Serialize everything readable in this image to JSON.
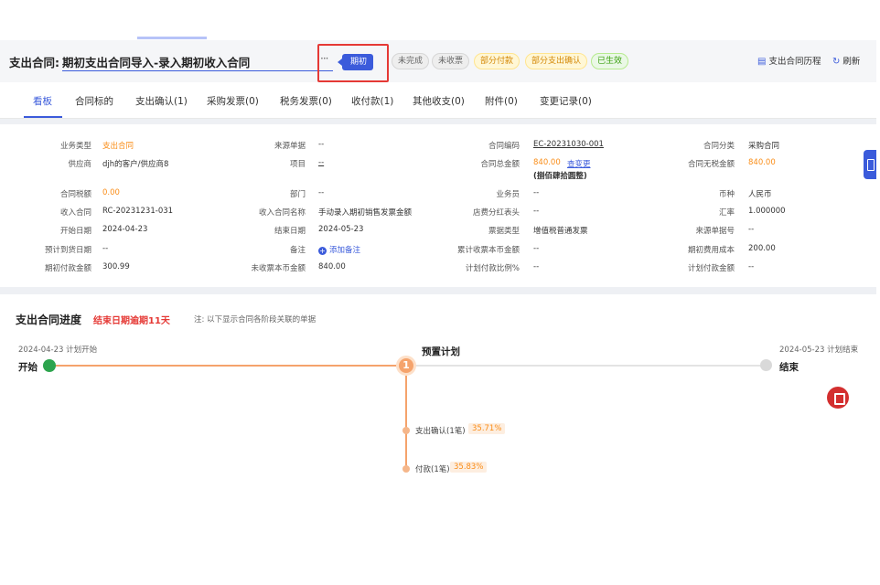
{
  "header": {
    "title_label": "支出合同:",
    "title_value": "期初支出合同导入-录入期初收入合同",
    "more": "···",
    "tag": "期初",
    "statuses": [
      "未完成",
      "未收票",
      "部分付款",
      "部分支出确认",
      "已生效"
    ],
    "actions": {
      "history": "支出合同历程",
      "refresh": "刷新"
    }
  },
  "tabs": [
    "看板",
    "合同标的",
    "支出确认(1)",
    "采购发票(0)",
    "税务发票(0)",
    "收付款(1)",
    "其他收支(0)",
    "附件(0)",
    "变更记录(0)"
  ],
  "info": {
    "col1": [
      {
        "label": "业务类型",
        "value": "支出合同"
      },
      {
        "label": "供应商",
        "value": "djh的客户/供应商8"
      },
      {
        "label": "合同税额",
        "value": "0.00"
      },
      {
        "label": "收入合同",
        "value": "RC-20231231-031"
      },
      {
        "label": "开始日期",
        "value": "2024-04-23"
      },
      {
        "label": "预计到货日期",
        "value": "--"
      },
      {
        "label": "期初付款金额",
        "value": "300.99"
      }
    ],
    "col2": [
      {
        "label": "来源单据",
        "value": "--"
      },
      {
        "label": "项目",
        "value": "--"
      },
      {
        "label": "部门",
        "value": "--"
      },
      {
        "label": "收入合同名称",
        "value": "手动录入期初销售发票金额"
      },
      {
        "label": "结束日期",
        "value": "2024-05-23"
      },
      {
        "label": "备注",
        "value": "添加备注"
      },
      {
        "label": "未收票本币金额",
        "value": "840.00"
      }
    ],
    "col3": [
      {
        "label": "合同编码",
        "value": "EC-20231030-001"
      },
      {
        "label": "合同总金额",
        "value": "840.00",
        "link": "查变更",
        "note": "(捌佰肆拾圆整)"
      },
      {
        "label": "业务员",
        "value": "--"
      },
      {
        "label": "店费分红表头",
        "value": "--"
      },
      {
        "label": "票据类型",
        "value": "增值税普通发票"
      },
      {
        "label": "累计收票本币金额",
        "value": "--"
      },
      {
        "label": "计划付款比例%",
        "value": "--"
      }
    ],
    "col4": [
      {
        "label": "合同分类",
        "value": "采购合同"
      },
      {
        "label": "合同无税金额",
        "value": "840.00"
      },
      {
        "label": "币种",
        "value": "人民币"
      },
      {
        "label": "汇率",
        "value": "1.000000"
      },
      {
        "label": "来源单据号",
        "value": "--"
      },
      {
        "label": "期初费用成本",
        "value": "200.00"
      },
      {
        "label": "计划付款金额",
        "value": "--"
      }
    ]
  },
  "progress": {
    "title": "支出合同进度",
    "overdue": "结束日期逾期11天",
    "note": "注: 以下显示合同各阶段关联的单据",
    "start": {
      "date": "2024-04-23 计划开始",
      "label": "开始"
    },
    "end": {
      "date": "2024-05-23 计划结束",
      "label": "结束"
    },
    "node": {
      "number": "1",
      "label": "预置计划"
    },
    "branches": [
      {
        "label": "支出确认(1笔)",
        "percent": "35.71%"
      },
      {
        "label": "付款(1笔)",
        "percent": "35.83%"
      }
    ]
  },
  "colors": {
    "accent": "#3b5bdb",
    "orange": "#fa8c16",
    "red": "#e53935",
    "green": "#2da44e"
  }
}
